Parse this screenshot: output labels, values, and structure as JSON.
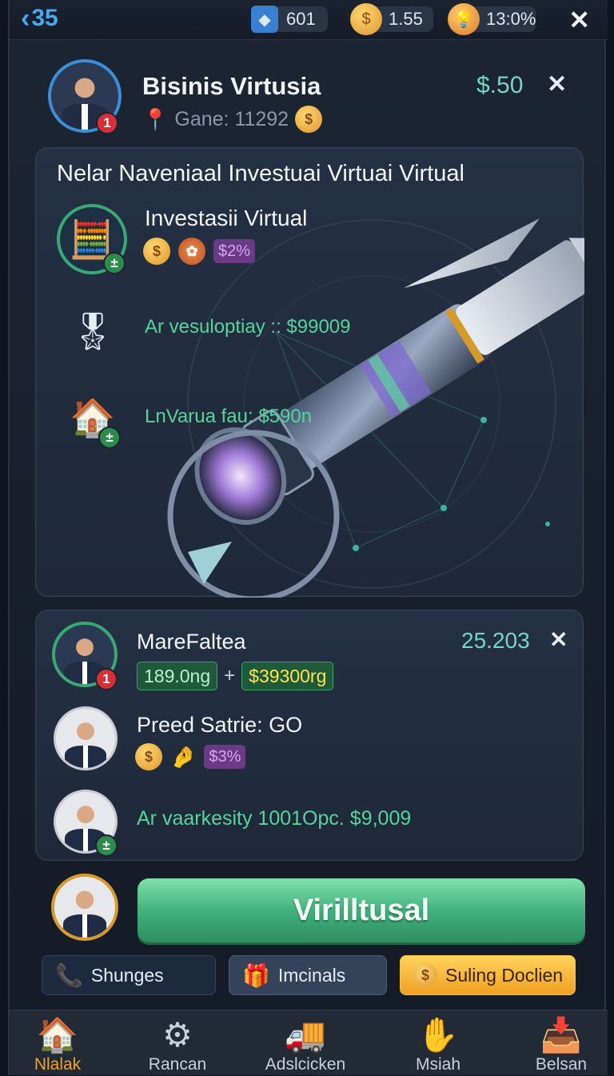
{
  "topbar": {
    "back_label": "35",
    "gems": "601",
    "coins": "1.55",
    "timer": "13:0%"
  },
  "profile": {
    "name": "Bisinis Virtusia",
    "game_id": "Gane: 11292",
    "balance": "$.50",
    "badge": "1"
  },
  "investment_panel": {
    "title": "Nelar Naveniaal Investuai Virtuai Virtual",
    "items": [
      {
        "label": "Investasii Virtual",
        "tag": "$2%",
        "icon": "calculator-icon"
      },
      {
        "label": "Ar vesuloptiay :: $99009",
        "icon": "certificate-icon"
      },
      {
        "label": "LnVarua fau: $590n",
        "icon": "house-icon"
      }
    ]
  },
  "players_panel": {
    "players": [
      {
        "name": "MareFaltea",
        "score": "25.203",
        "tag1": "189.0ng",
        "plus": "+",
        "tag2": "$39300rg",
        "badge": "1"
      },
      {
        "name": "Preed Satrie: GO",
        "tag": "$3%"
      },
      {
        "name": "Ar vaarkesity 1001Opc. $9,009"
      }
    ]
  },
  "cta": {
    "label": "Virilltusal"
  },
  "secondary_buttons": [
    {
      "label": "Shunges",
      "icon": "phone-icon"
    },
    {
      "label": "Imcinals",
      "icon": "gift-icon"
    },
    {
      "label": "Suling Doclien",
      "icon": "coin-icon"
    }
  ],
  "nav": [
    {
      "label": "Nlalak",
      "icon": "home-icon"
    },
    {
      "label": "Rancan",
      "icon": "gear-icon"
    },
    {
      "label": "Adslcicken",
      "icon": "truck-icon"
    },
    {
      "label": "Msiah",
      "icon": "hand-icon"
    },
    {
      "label": "Belsan",
      "icon": "inbox-icon"
    }
  ],
  "colors": {
    "accent": "#57d39c",
    "money": "#74d6c8",
    "nav_active": "#f0a02a"
  }
}
